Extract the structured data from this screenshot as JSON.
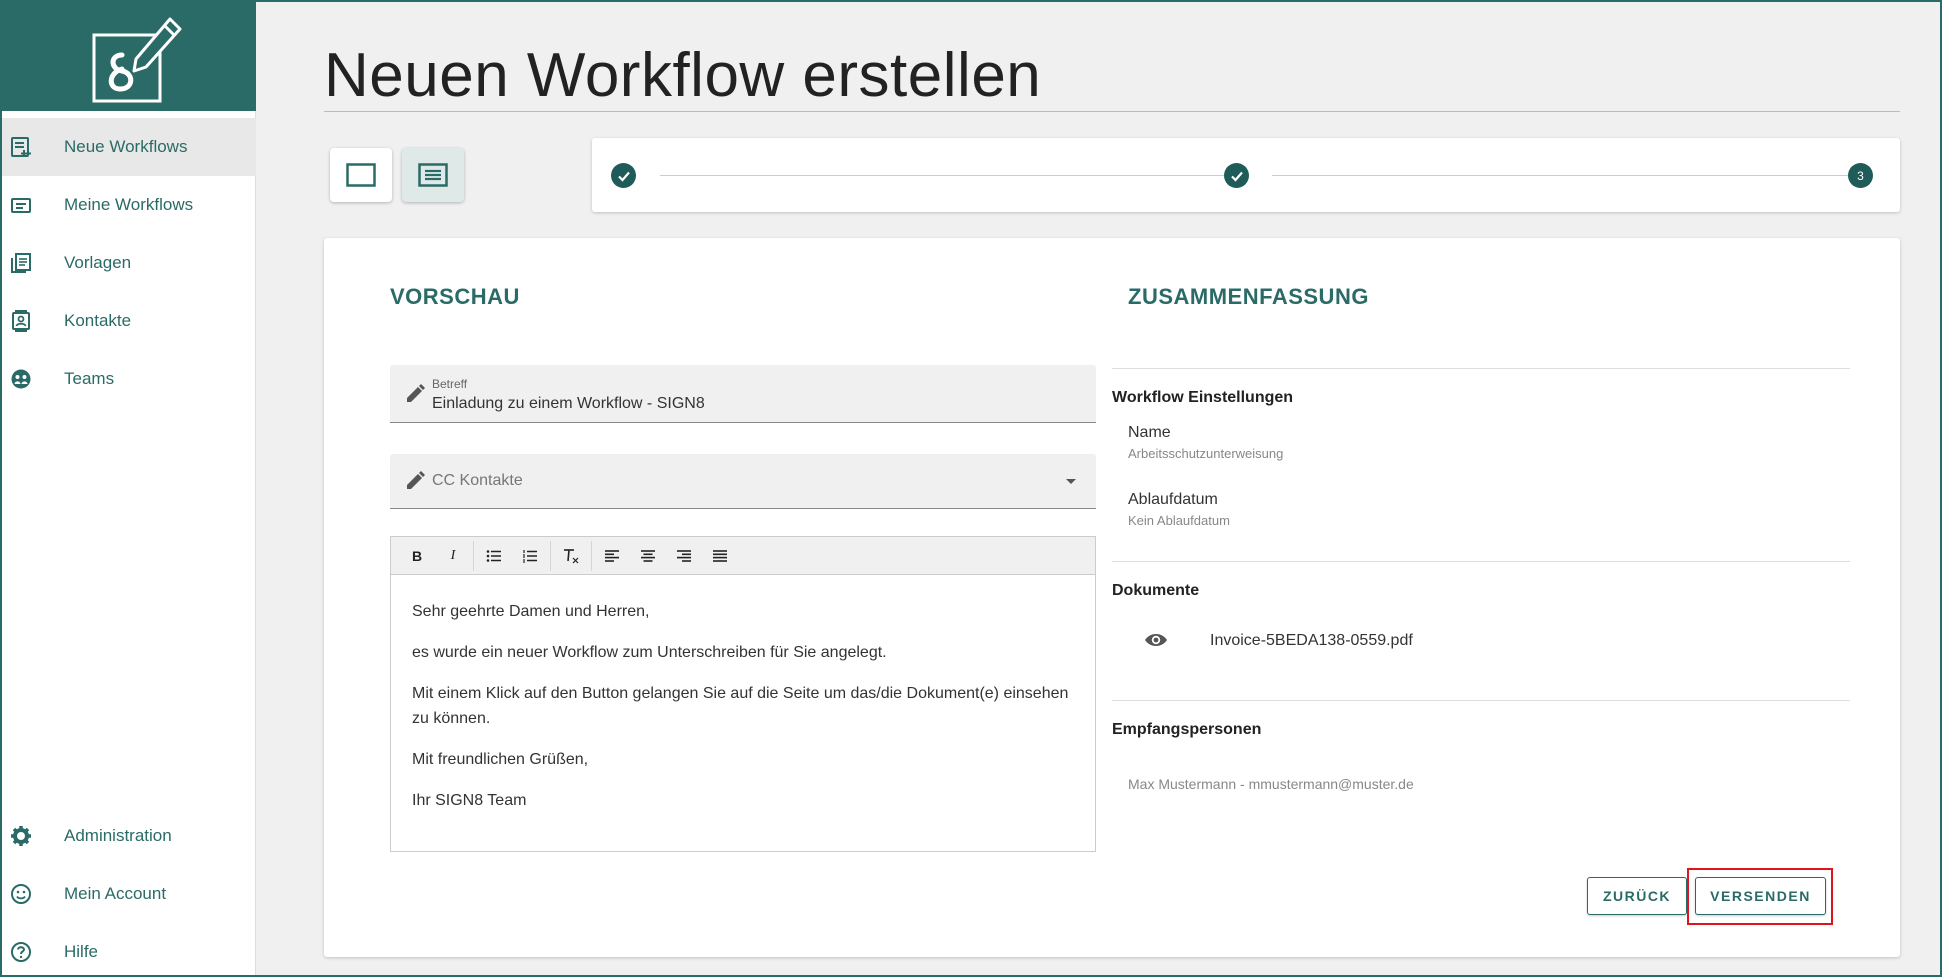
{
  "sidebar": {
    "items": [
      {
        "label": "Neue Workflows",
        "icon": "new-document-icon"
      },
      {
        "label": "Meine Workflows",
        "icon": "folder-icon"
      },
      {
        "label": "Vorlagen",
        "icon": "templates-icon"
      },
      {
        "label": "Kontakte",
        "icon": "contacts-icon"
      },
      {
        "label": "Teams",
        "icon": "teams-icon"
      }
    ],
    "bottom_items": [
      {
        "label": "Administration",
        "icon": "gear-icon"
      },
      {
        "label": "Mein Account",
        "icon": "smiley-icon"
      },
      {
        "label": "Hilfe",
        "icon": "help-icon"
      }
    ]
  },
  "page": {
    "title": "Neuen Workflow erstellen"
  },
  "stepper": {
    "step3_label": "3"
  },
  "preview": {
    "heading": "VORSCHAU",
    "subject_label": "Betreff",
    "subject_value": "Einladung zu einem Workflow - SIGN8",
    "cc_placeholder": "CC Kontakte",
    "body": [
      "Sehr geehrte Damen und Herren,",
      "es wurde ein neuer Workflow zum Unterschreiben für Sie angelegt.",
      "Mit einem Klick auf den Button gelangen Sie auf die Seite um das/die Dokument(e) einsehen zu können.",
      "Mit freundlichen Grüßen,",
      "Ihr SIGN8 Team"
    ]
  },
  "summary": {
    "heading": "ZUSAMMENFASSUNG",
    "settings_heading": "Workflow Einstellungen",
    "name_label": "Name",
    "name_value": "Arbeitsschutzunterweisung",
    "expiry_label": "Ablaufdatum",
    "expiry_value": "Kein Ablaufdatum",
    "documents_heading": "Dokumente",
    "document_name": "Invoice-5BEDA138-0559.pdf",
    "recipients_heading": "Empfangspersonen",
    "recipient": "Max Mustermann - mmustermann@muster.de"
  },
  "actions": {
    "back_label": "ZURÜCK",
    "send_label": "VERSENDEN"
  },
  "colors": {
    "brand": "#2a6b67",
    "step": "#1f5c59",
    "highlight": "#e0141e"
  }
}
